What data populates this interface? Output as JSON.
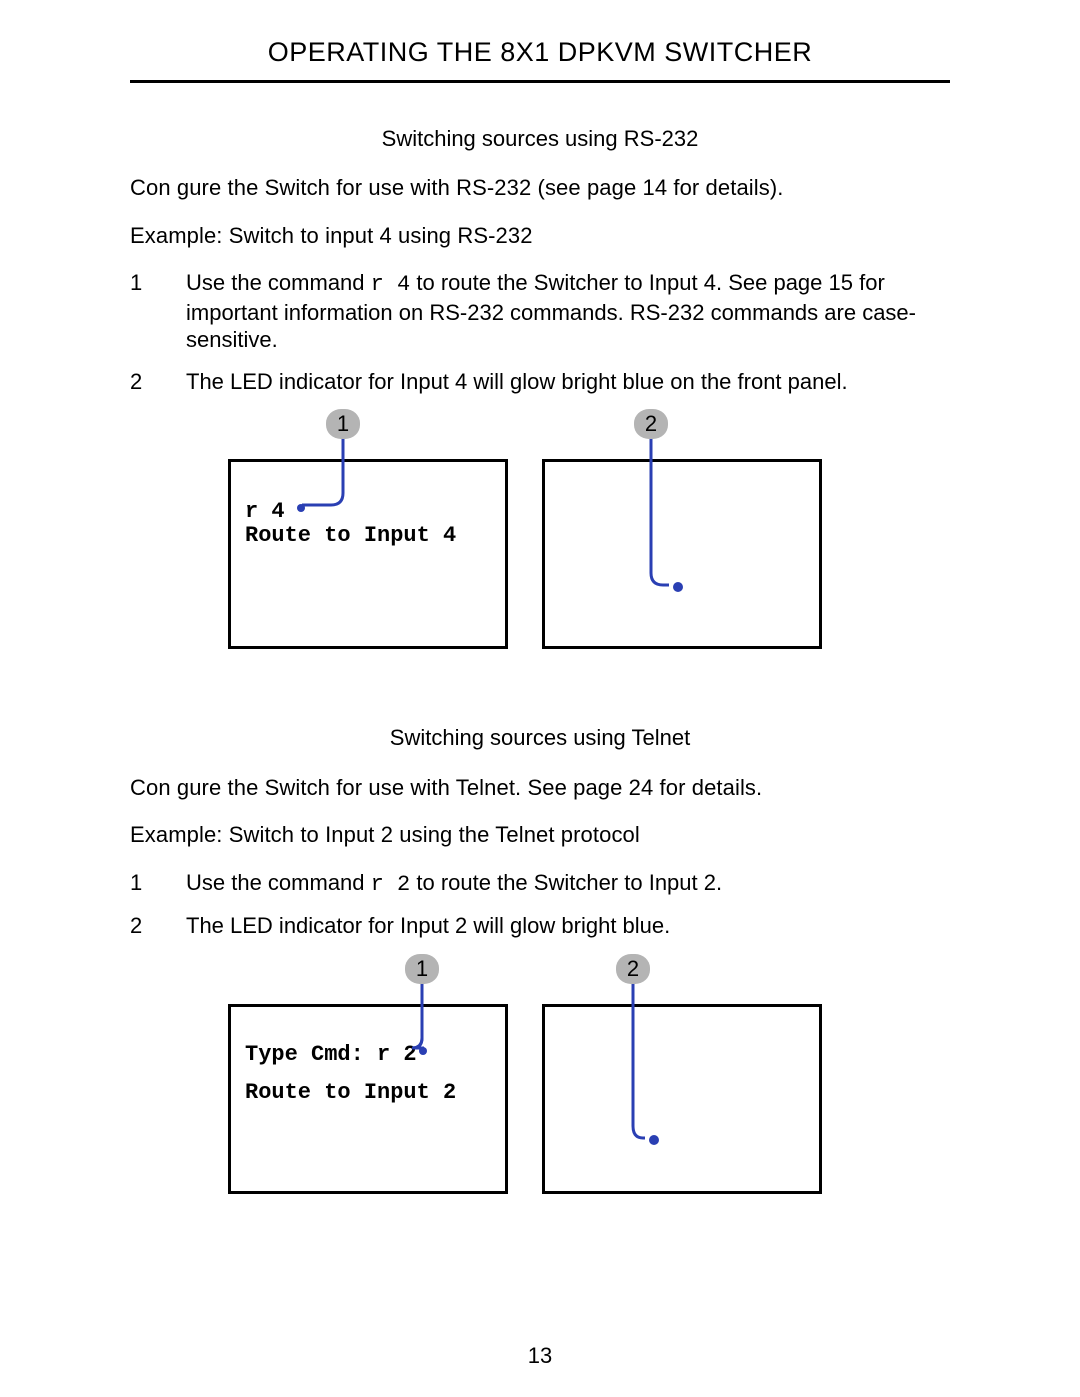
{
  "page": {
    "title": "OPERATING THE 8X1 DPKVM SWITCHER",
    "number": "13"
  },
  "section1": {
    "heading": "Switching sources using RS-232",
    "intro": "Con   gure the Switch for use with RS-232 (see page 14 for details).",
    "example": "Example: Switch to input 4 using RS-232",
    "step1_num": "1",
    "step1_pre": "Use the command ",
    "step1_cmd": "r 4",
    "step1_post": " to route the Switcher to Input 4.  See page 15 for important information on RS-232 commands.  RS-232 commands are case-sensitive.",
    "step2_num": "2",
    "step2_text": "The LED indicator for Input 4 will glow bright blue on the front panel.",
    "callout1": "1",
    "callout2": "2",
    "box1_line1": "r 4",
    "box1_line2": "Route to Input 4"
  },
  "section2": {
    "heading": "Switching sources using Telnet",
    "intro": "Con   gure the Switch for use with Telnet.  See page 24 for details.",
    "example": "Example: Switch to Input 2 using the Telnet protocol",
    "step1_num": "1",
    "step1_pre": "Use the command ",
    "step1_cmd": "r 2",
    "step1_post": " to route the Switcher to Input 2.",
    "step2_num": "2",
    "step2_text": "The LED indicator for Input 2 will glow bright blue.",
    "callout1": "1",
    "callout2": "2",
    "box1_line1": "Type Cmd: r 2",
    "box1_line2": "Route to Input 2"
  }
}
